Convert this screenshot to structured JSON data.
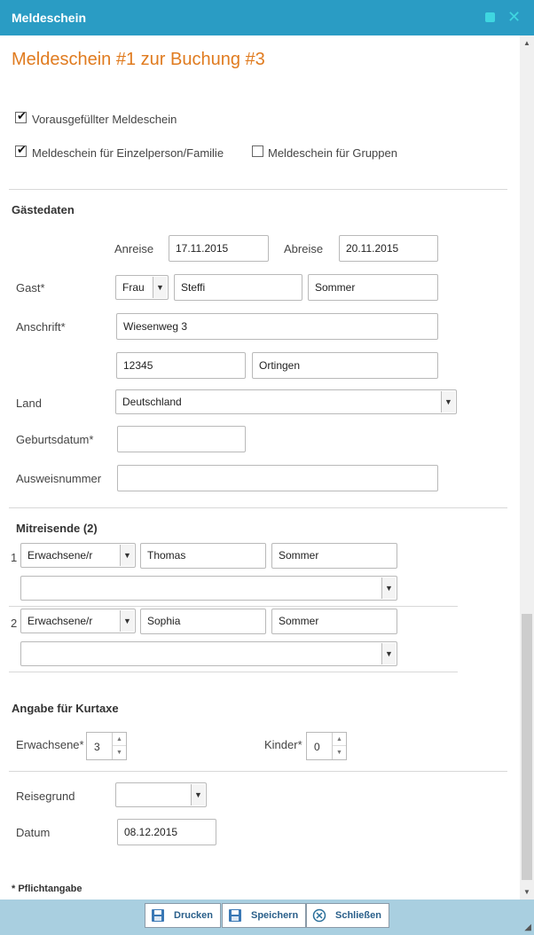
{
  "window": {
    "title": "Meldeschein"
  },
  "page": {
    "heading": "Meldeschein #1 zur Buchung #3"
  },
  "options": {
    "prefilled": {
      "label": "Vorausgefüllter Meldeschein",
      "checked": true
    },
    "single": {
      "label": "Meldeschein für Einzelperson/Familie",
      "checked": true
    },
    "groups": {
      "label": "Meldeschein für Gruppen",
      "checked": false
    }
  },
  "guest": {
    "section": "Gästedaten",
    "arrival_label": "Anreise",
    "arrival": "17.11.2015",
    "departure_label": "Abreise",
    "departure": "20.11.2015",
    "guest_label": "Gast*",
    "salutation": "Frau",
    "firstname": "Steffi",
    "lastname": "Sommer",
    "address_label": "Anschrift*",
    "street": "Wiesenweg 3",
    "zip": "12345",
    "city": "Ortingen",
    "country_label": "Land",
    "country": "Deutschland",
    "birthdate_label": "Geburtsdatum*",
    "birthdate": "",
    "id_label": "Ausweisnummer",
    "id_number": ""
  },
  "companions": {
    "section": "Mitreisende (2)",
    "items": [
      {
        "index": "1",
        "type": "Erwachsene/r",
        "firstname": "Thomas",
        "lastname": "Sommer",
        "extra": ""
      },
      {
        "index": "2",
        "type": "Erwachsene/r",
        "firstname": "Sophia",
        "lastname": "Sommer",
        "extra": ""
      }
    ]
  },
  "tax": {
    "section": "Angabe für Kurtaxe",
    "adults_label": "Erwachsene*",
    "adults": "3",
    "children_label": "Kinder*",
    "children": "0"
  },
  "trip": {
    "reason_label": "Reisegrund",
    "reason": "",
    "date_label": "Datum",
    "date": "08.12.2015"
  },
  "footer": {
    "note": "* Pflichtangabe",
    "print": "Drucken",
    "save": "Speichern",
    "close": "Schließen"
  },
  "colors": {
    "titlebar": "#2a9cc4",
    "heading": "#e07b1f",
    "footer": "#a9cfe0"
  }
}
